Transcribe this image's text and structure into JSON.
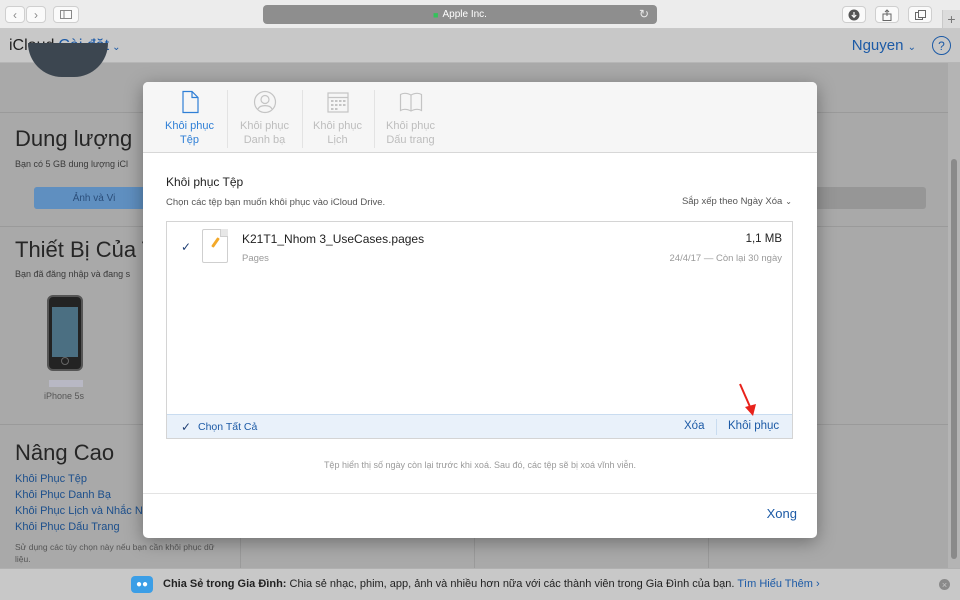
{
  "browser": {
    "url_text": "Apple Inc.",
    "back_icon": "chevron-left-icon",
    "forward_icon": "chevron-right-icon"
  },
  "header": {
    "brand": "iCloud",
    "section": "Cài đặt",
    "user_name": "Nguyen",
    "help": "?"
  },
  "background": {
    "storage_title": "Dung lượng",
    "storage_sub": "Bạn có 5 GB dung lượng iCl",
    "storage_bar_label": "Ảnh và Vi",
    "devices_title": "Thiết Bị Của T",
    "devices_sub": "Bạn đã đăng nhập và đang s",
    "device_name": "iPhone 5s",
    "advanced_title": "Nâng Cao",
    "advanced_links": [
      "Khôi Phục Tệp",
      "Khôi Phục Danh Bạ",
      "Khôi Phục Lịch và Nhắc N",
      "Khôi Phục Dấu Trang"
    ],
    "advanced_note": "Sử dụng các tùy chọn này nếu bạn cần khôi phục dữ liệu."
  },
  "modal": {
    "tabs": [
      {
        "label": "Khôi phục Tệp",
        "icon": "document-icon",
        "active": true
      },
      {
        "label": "Khôi phục Danh bạ",
        "icon": "contact-icon",
        "active": false
      },
      {
        "label": "Khôi phục Lịch",
        "icon": "calendar-icon",
        "active": false
      },
      {
        "label": "Khôi phục Dấu trang",
        "icon": "book-icon",
        "active": false
      }
    ],
    "title": "Khôi phục Tệp",
    "description": "Chọn các tệp bạn muốn khôi phục vào iCloud Drive.",
    "sort_label": "Sắp xếp theo Ngày Xóa",
    "files": [
      {
        "name": "K21T1_Nhom 3_UseCases.pages",
        "kind": "Pages",
        "size": "1,1 MB",
        "date": "24/4/17 — Còn lại 30 ngày",
        "checked": true
      }
    ],
    "select_all": "Chọn Tất Cả",
    "delete_label": "Xóa",
    "restore_label": "Khôi phục",
    "note": "Tệp hiển thị số ngày còn lại trước khi xoá. Sau đó, các tệp sẽ bị xoá vĩnh viễn.",
    "done_label": "Xong"
  },
  "banner": {
    "title": "Chia Sẻ trong Gia Đình:",
    "text": "Chia sẻ nhạc, phim, app, ảnh và nhiều hơn nữa với các thành viên trong Gia Đình của bạn.",
    "link": "Tìm Hiểu Thêm ›"
  },
  "colors": {
    "accent": "#2f7fd6",
    "link": "#1c5aa6",
    "arrow": "#e8221b"
  }
}
